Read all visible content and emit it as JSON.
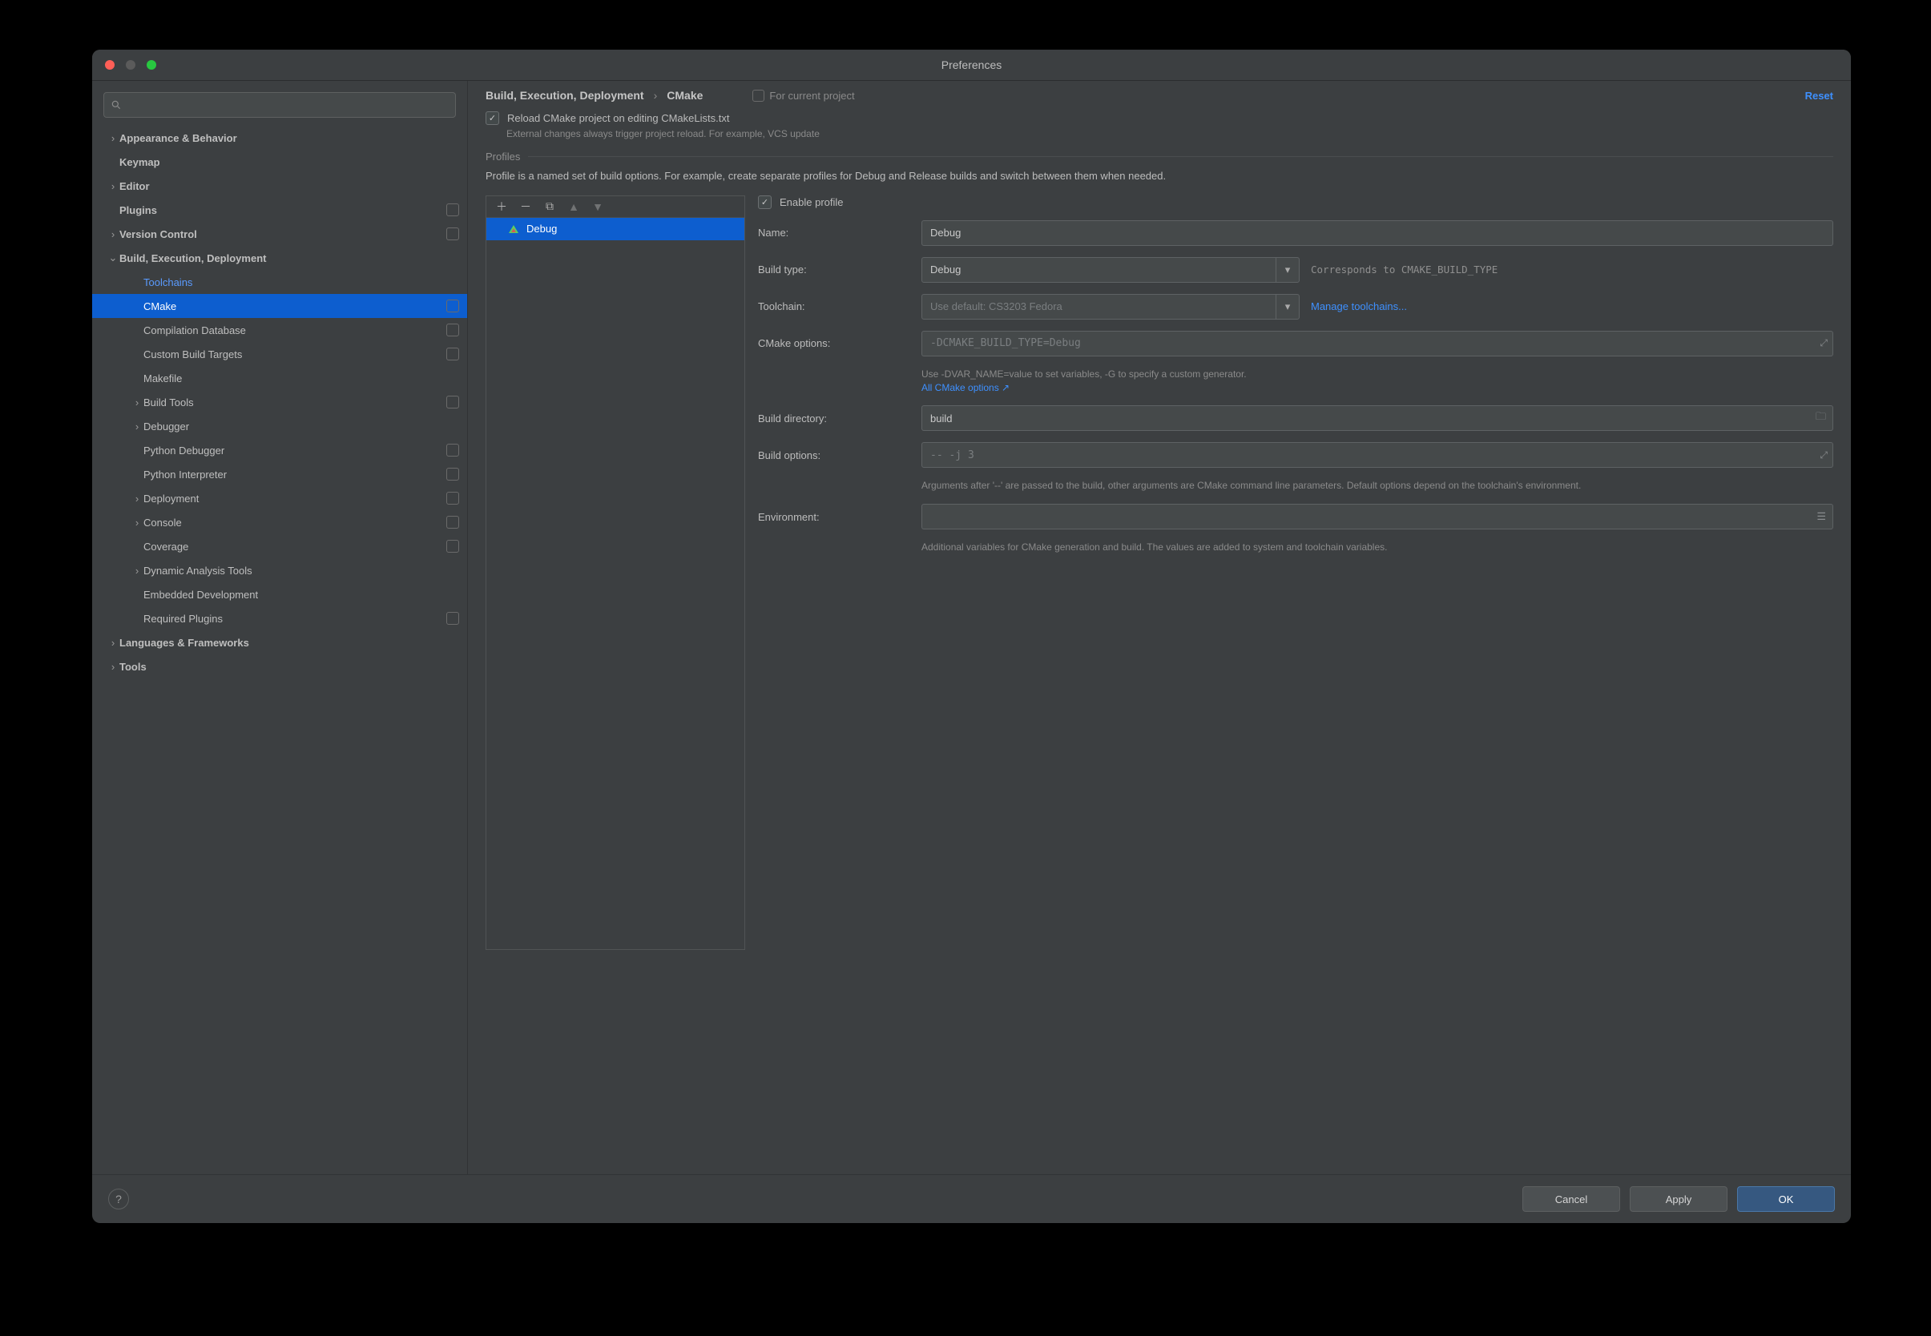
{
  "window": {
    "title": "Preferences"
  },
  "sidebar": {
    "search_placeholder": "",
    "items": [
      {
        "label": "Appearance & Behavior",
        "bold": true,
        "chev": "right",
        "indent": 0
      },
      {
        "label": "Keymap",
        "bold": true,
        "indent": 0
      },
      {
        "label": "Editor",
        "bold": true,
        "chev": "right",
        "indent": 0
      },
      {
        "label": "Plugins",
        "bold": true,
        "indent": 0,
        "badge": true
      },
      {
        "label": "Version Control",
        "bold": true,
        "chev": "right",
        "indent": 0,
        "badge": true
      },
      {
        "label": "Build, Execution, Deployment",
        "bold": true,
        "chev": "down",
        "indent": 0
      },
      {
        "label": "Toolchains",
        "indent": 1,
        "link": true
      },
      {
        "label": "CMake",
        "indent": 1,
        "selected": true,
        "badge": true
      },
      {
        "label": "Compilation Database",
        "indent": 1,
        "badge": true
      },
      {
        "label": "Custom Build Targets",
        "indent": 1,
        "badge": true
      },
      {
        "label": "Makefile",
        "indent": 1
      },
      {
        "label": "Build Tools",
        "indent": 1,
        "chev": "right",
        "badge": true
      },
      {
        "label": "Debugger",
        "indent": 1,
        "chev": "right"
      },
      {
        "label": "Python Debugger",
        "indent": 1,
        "badge": true
      },
      {
        "label": "Python Interpreter",
        "indent": 1,
        "badge": true
      },
      {
        "label": "Deployment",
        "indent": 1,
        "chev": "right",
        "badge": true
      },
      {
        "label": "Console",
        "indent": 1,
        "chev": "right",
        "badge": true
      },
      {
        "label": "Coverage",
        "indent": 1,
        "badge": true
      },
      {
        "label": "Dynamic Analysis Tools",
        "indent": 1,
        "chev": "right"
      },
      {
        "label": "Embedded Development",
        "indent": 1
      },
      {
        "label": "Required Plugins",
        "indent": 1,
        "badge": true
      },
      {
        "label": "Languages & Frameworks",
        "bold": true,
        "chev": "right",
        "indent": 0
      },
      {
        "label": "Tools",
        "bold": true,
        "chev": "right",
        "indent": 0
      }
    ]
  },
  "header": {
    "breadcrumb_parent": "Build, Execution, Deployment",
    "breadcrumb_leaf": "CMake",
    "scope": "For current project",
    "reset": "Reset"
  },
  "top": {
    "reload_label": "Reload CMake project on editing CMakeLists.txt",
    "reload_hint": "External changes always trigger project reload. For example, VCS update"
  },
  "profiles": {
    "section": "Profiles",
    "desc": "Profile is a named set of build options. For example, create separate profiles for Debug and Release builds and switch between them when needed.",
    "selected": "Debug",
    "enable_label": "Enable profile",
    "name_label": "Name:",
    "name_value": "Debug",
    "buildtype_label": "Build type:",
    "buildtype_value": "Debug",
    "buildtype_after": "Corresponds to CMAKE_BUILD_TYPE",
    "toolchain_label": "Toolchain:",
    "toolchain_value": "Use default: CS3203 Fedora",
    "manage_link": "Manage toolchains...",
    "cmakeopts_label": "CMake options:",
    "cmakeopts_placeholder": "-DCMAKE_BUILD_TYPE=Debug",
    "cmakeopts_hint": "Use -DVAR_NAME=value to set variables, -G to specify a custom generator.",
    "cmakeopts_link": "All CMake options ↗",
    "builddir_label": "Build directory:",
    "builddir_value": "build",
    "buildopts_label": "Build options:",
    "buildopts_placeholder": "-- -j 3",
    "buildopts_hint": "Arguments after '--' are passed to the build, other arguments are CMake command line parameters. Default options depend on the toolchain's environment.",
    "env_label": "Environment:",
    "env_hint": "Additional variables for CMake generation and build. The values are added to system and toolchain variables."
  },
  "footer": {
    "cancel": "Cancel",
    "apply": "Apply",
    "ok": "OK"
  }
}
